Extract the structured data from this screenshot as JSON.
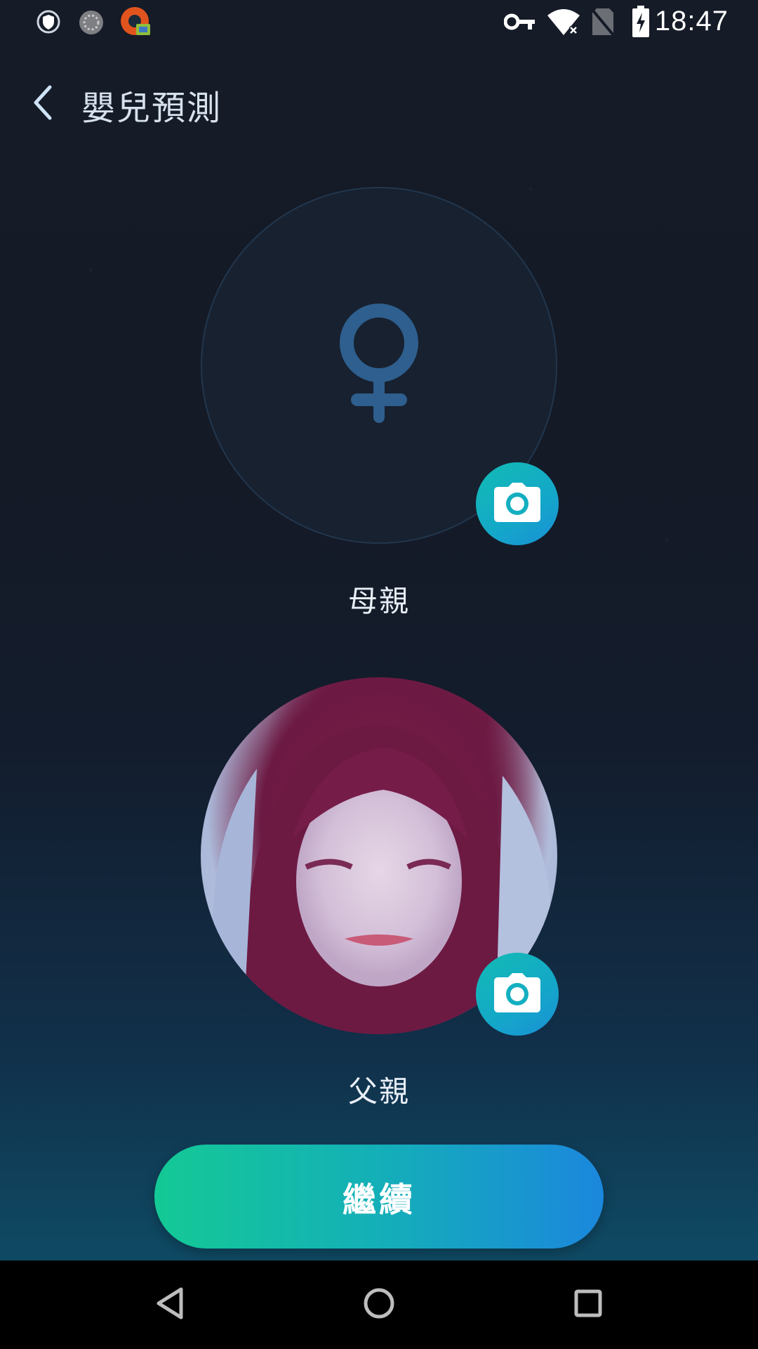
{
  "status_bar": {
    "time": "18:47",
    "left_icons": [
      "shield-icon",
      "loading-icon",
      "app-icon"
    ],
    "right_icons": [
      "vpn-key-icon",
      "wifi-icon",
      "no-sim-icon",
      "battery-charging-icon"
    ]
  },
  "header": {
    "title": "嬰兒預測",
    "back_icon": "chevron-left-icon"
  },
  "mother": {
    "label": "母親",
    "placeholder_icon": "female-symbol-icon",
    "camera_icon": "camera-icon"
  },
  "father": {
    "label": "父親",
    "camera_icon": "camera-icon"
  },
  "actions": {
    "continue_label": "繼續"
  },
  "navigation": {
    "back_icon": "triangle-back-icon",
    "home_icon": "circle-home-icon",
    "recents_icon": "square-recents-icon"
  },
  "colors": {
    "accent_start": "#14c995",
    "accent_end": "#1b87dd",
    "placeholder_symbol": "#2e5f8e",
    "label_text": "#e8eef6"
  }
}
